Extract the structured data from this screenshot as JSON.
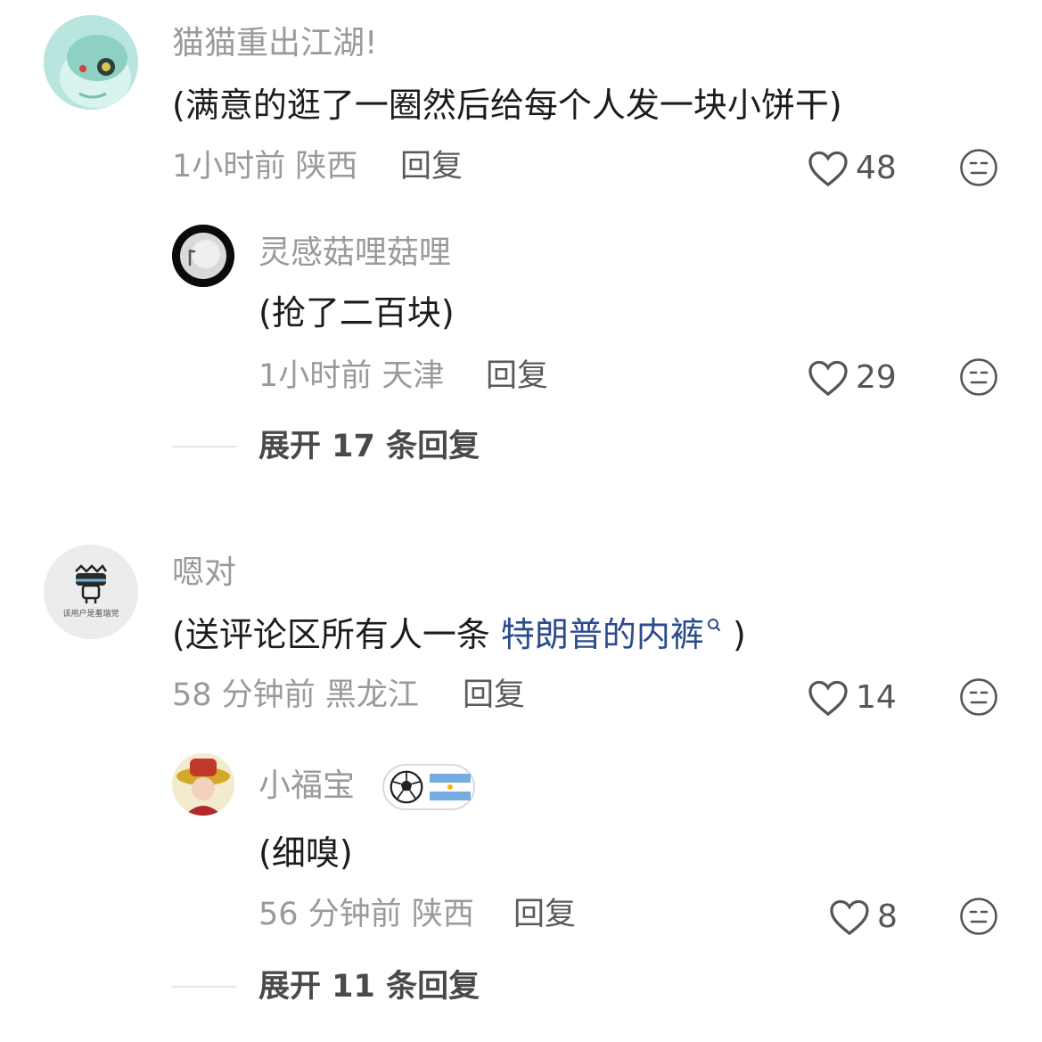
{
  "comments": [
    {
      "username": "猫猫重出江湖!",
      "text": "(满意的逛了一圈然后给每个人发一块小饼干)",
      "time": "1小时前",
      "location": "陕西",
      "reply_label": "回复",
      "likes": "48",
      "reply": {
        "username": "灵感菇哩菇哩",
        "text": "(抢了二百块)",
        "time": "1小时前",
        "location": "天津",
        "reply_label": "回复",
        "likes": "29"
      },
      "expand_label": "展开 17 条回复"
    },
    {
      "username": "嗯对",
      "avatar_text": "该用户是羞瑞党",
      "text_prefix": "(送评论区所有人一条 ",
      "link_text": "特朗普的内裤",
      "text_suffix": " )",
      "time": "58 分钟前",
      "location": "黑龙江",
      "reply_label": "回复",
      "likes": "14",
      "reply": {
        "username": "小福宝",
        "text": "(细嗅)",
        "time": "56 分钟前",
        "location": "陕西",
        "reply_label": "回复",
        "likes": "8"
      },
      "expand_label": "展开 11 条回复"
    }
  ],
  "icons": {
    "like": "heart-outline-icon",
    "dislike": "neutral-face-icon",
    "search": "search-icon",
    "badge": "football-argentina-flag-icon"
  },
  "colors": {
    "link": "#2b4b8c",
    "secondary_text": "#9a9a9a",
    "primary_text": "#1c1c1c"
  }
}
